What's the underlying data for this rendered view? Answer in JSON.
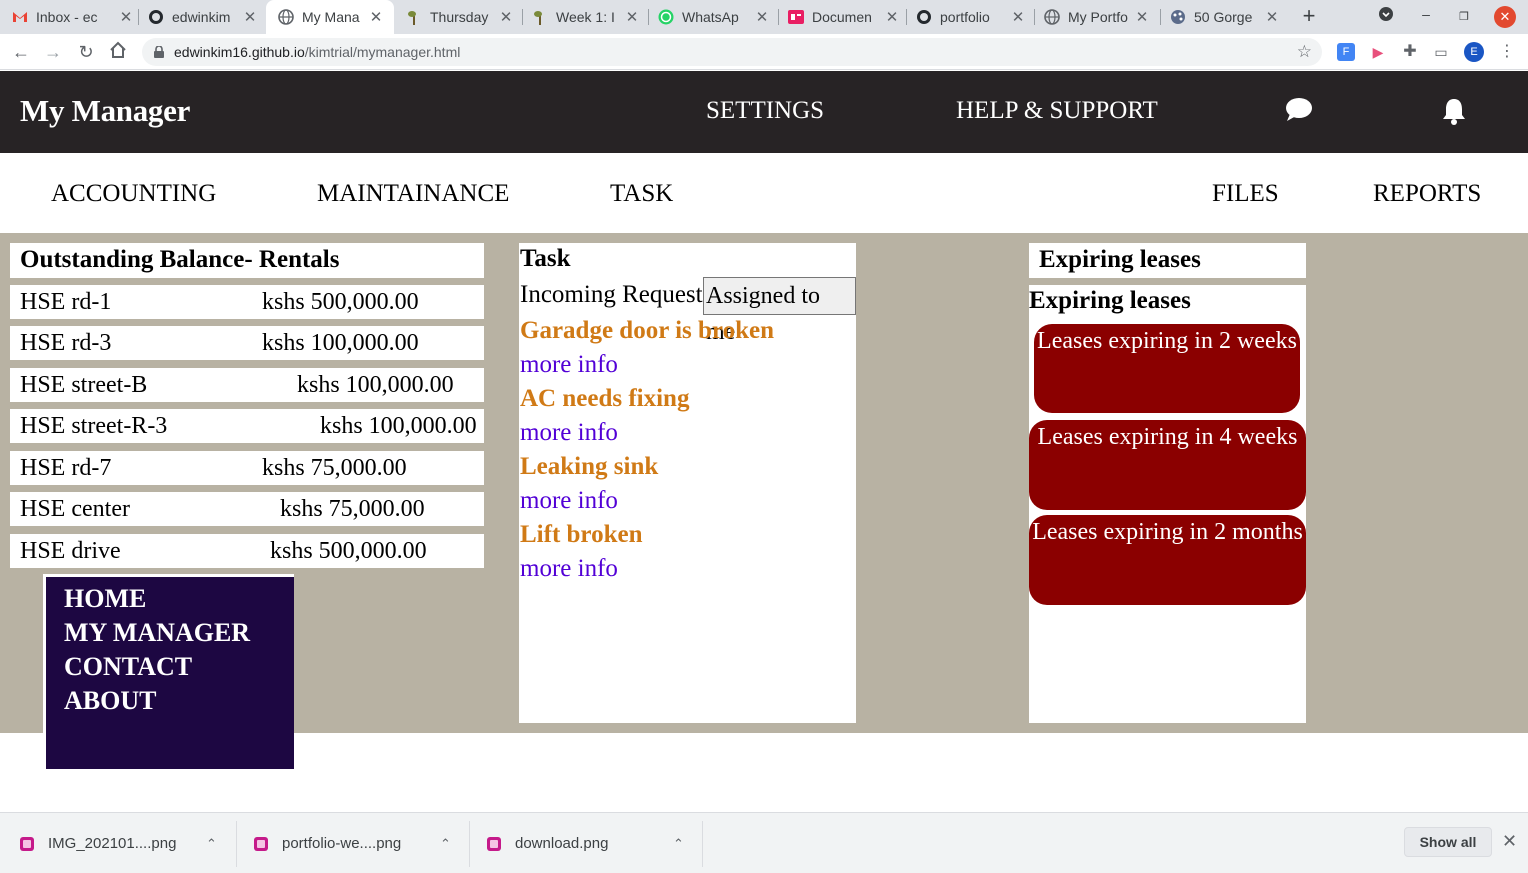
{
  "browser": {
    "tabs": [
      {
        "title": "Inbox - ec",
        "icon": "gmail-icon"
      },
      {
        "title": "edwinkim",
        "icon": "github-icon"
      },
      {
        "title": "My Mana",
        "icon": "globe-icon"
      },
      {
        "title": "Thursday",
        "icon": "plant-icon"
      },
      {
        "title": "Week 1: I",
        "icon": "plant-icon"
      },
      {
        "title": "WhatsAp",
        "icon": "whatsapp-icon"
      },
      {
        "title": "Documen",
        "icon": "document-icon"
      },
      {
        "title": "portfolio",
        "icon": "github-icon"
      },
      {
        "title": "My Portfo",
        "icon": "globe-icon"
      },
      {
        "title": "50 Gorge",
        "icon": "palette-icon"
      }
    ],
    "url_host": "edwinkim16.github.io",
    "url_path": "/kimtrial/mymanager.html",
    "profile_initial": "E"
  },
  "header": {
    "brand": "My Manager",
    "settings": "SETTINGS",
    "help": "HELP & SUPPORT"
  },
  "subnav": {
    "accounting": "ACCOUNTING",
    "maintainance": "MAINTAINANCE",
    "task": "TASK",
    "files": "FILES",
    "reports": "REPORTS"
  },
  "balance": {
    "title": "Outstanding Balance- Rentals",
    "rows": [
      {
        "name": "HSE rd-1",
        "amount": "kshs 500,000.00"
      },
      {
        "name": "HSE rd-3",
        "amount": "kshs 100,000.00"
      },
      {
        "name": "HSE street-B",
        "amount": "kshs 100,000.00"
      },
      {
        "name": "HSE street-R-3",
        "amount": "kshs 100,000.00"
      },
      {
        "name": "HSE rd-7",
        "amount": "kshs 75,000.00"
      },
      {
        "name": "HSE center",
        "amount": "kshs 75,000.00"
      },
      {
        "name": "HSE drive",
        "amount": "kshs 500,000.00"
      }
    ]
  },
  "sidemenu": [
    "HOME",
    "MY MANAGER",
    "CONTACT",
    "ABOUT"
  ],
  "task": {
    "title": "Task",
    "incoming": "Incoming Request",
    "assigned": "Assigned to me",
    "items": [
      {
        "title": "Garadge door is broken",
        "link": "more info"
      },
      {
        "title": "AC needs fixing",
        "link": "more info"
      },
      {
        "title": "Leaking sink",
        "link": "more info"
      },
      {
        "title": "Lift broken",
        "link": "more info"
      }
    ]
  },
  "leases": {
    "panel_title": "Expiring leases",
    "box_title": "Expiring leases",
    "buttons": [
      "Leases expiring in 2 weeks",
      "Leases expiring in 4 weeks",
      "Leases expiring in 2 months"
    ]
  },
  "downloads": {
    "files": [
      "IMG_202101....png",
      "portfolio-we....png",
      "download.png"
    ],
    "show_all": "Show all"
  },
  "colors": {
    "header_bg": "#272325",
    "content_bg": "#b8b2a3",
    "task_title": "#d07a16",
    "link": "#5200d6",
    "lease_button": "#8b0000",
    "sidemenu_bg": "#1d0742"
  }
}
